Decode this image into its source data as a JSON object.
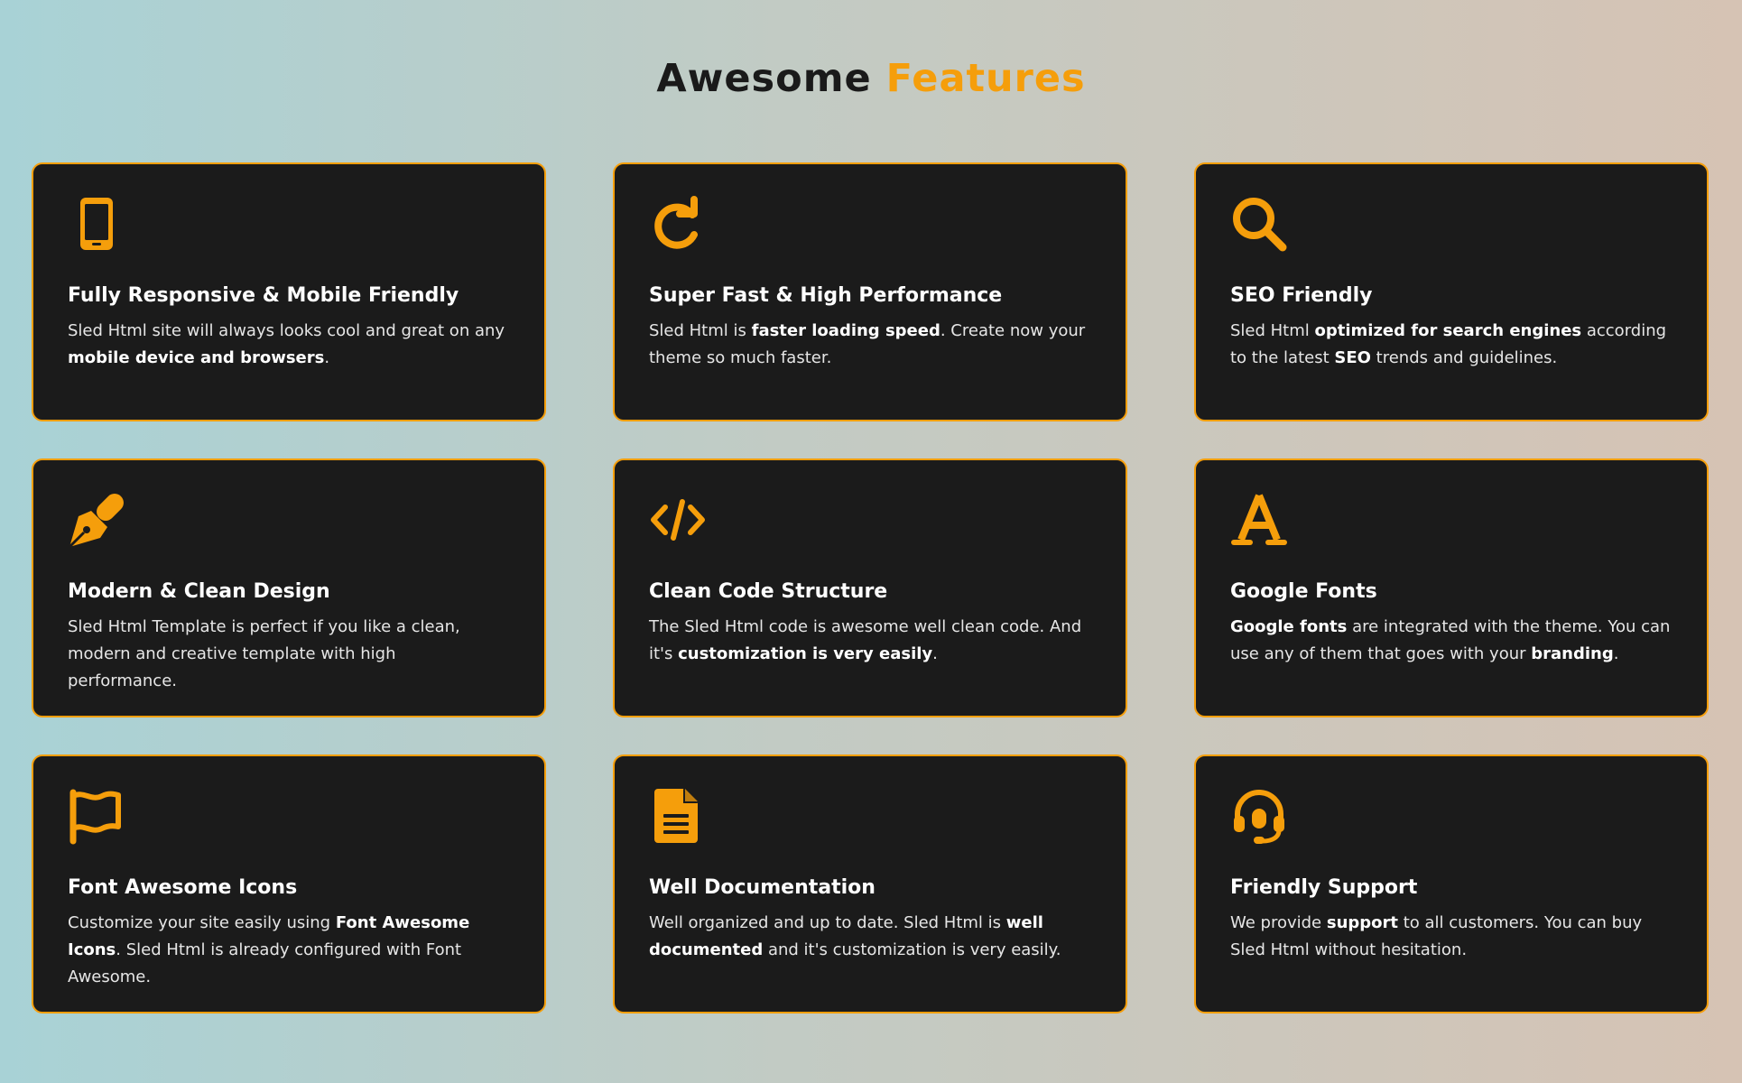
{
  "heading": {
    "word1": "Awesome",
    "word2": "Features"
  },
  "colors": {
    "accent": "#f59e0b",
    "card_bg": "#1b1b1b"
  },
  "cards": [
    {
      "icon": "mobile-icon",
      "title": "Fully Responsive & Mobile Friendly",
      "desc": [
        "Sled Html site will always looks cool and great on any ",
        "mobile device and browsers",
        "."
      ]
    },
    {
      "icon": "refresh-icon",
      "title": "Super Fast & High Performance",
      "desc": [
        "Sled Html is ",
        "faster loading speed",
        ". Create now your theme so much faster."
      ]
    },
    {
      "icon": "search-icon",
      "title": "SEO Friendly",
      "desc": [
        "Sled Html ",
        "optimized for search engines",
        " according to the latest ",
        "SEO",
        " trends and guidelines."
      ]
    },
    {
      "icon": "pen-nib-icon",
      "title": "Modern & Clean Design",
      "desc": [
        "Sled Html Template is perfect if you like a clean, modern and creative template with high performance."
      ]
    },
    {
      "icon": "code-icon",
      "title": "Clean Code Structure",
      "desc": [
        "The Sled Html code is awesome well clean code. And it's ",
        "customization is very easily",
        "."
      ]
    },
    {
      "icon": "font-icon",
      "title": "Google Fonts",
      "desc": [
        "",
        "Google fonts",
        " are integrated with the theme. You can use any of them that goes with your ",
        "branding",
        "."
      ]
    },
    {
      "icon": "flag-icon",
      "title": "Font Awesome Icons",
      "desc": [
        "Customize your site easily using ",
        "Font Awesome Icons",
        ". Sled Html is already configured with Font Awesome."
      ]
    },
    {
      "icon": "document-icon",
      "title": "Well Documentation",
      "desc": [
        "Well organized and up to date. Sled Html is ",
        "well documented",
        " and it's customization is very easily."
      ]
    },
    {
      "icon": "headset-icon",
      "title": "Friendly Support",
      "desc": [
        "We provide ",
        "support",
        " to all customers. You can buy Sled Html without hesitation."
      ]
    }
  ]
}
